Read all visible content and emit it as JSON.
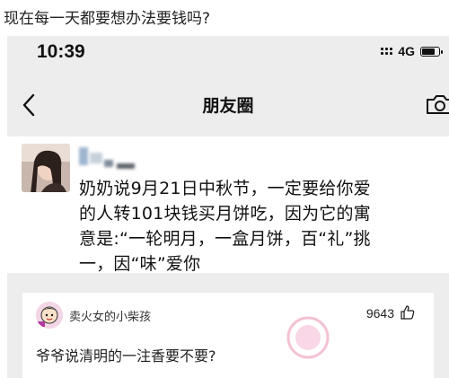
{
  "question": {
    "text": "现在每一天都要想办法要钱吗?"
  },
  "status_bar": {
    "time": "10:39",
    "network": "4G",
    "battery_level": 0.85
  },
  "nav": {
    "title": "朋友圈",
    "back_icon": "chevron-left-icon",
    "camera_icon": "camera-icon"
  },
  "post": {
    "lines": [
      "奶奶说9月21日中秋节，一定要给你爱",
      "的人转101块钱买月饼吃，因为它的寓",
      "意是:“一轮明月，一盒月饼，百“礼”挑",
      "一，因“味”爱你"
    ]
  },
  "comment": {
    "author": "卖火女的小柴孩",
    "likes": "9643",
    "text": "爷爷说清明的一注香要不要?",
    "like_icon": "thumbs-up-icon"
  },
  "colors": {
    "page_bg": "#ededed",
    "card_bg": "#ffffff",
    "text": "#111111"
  }
}
